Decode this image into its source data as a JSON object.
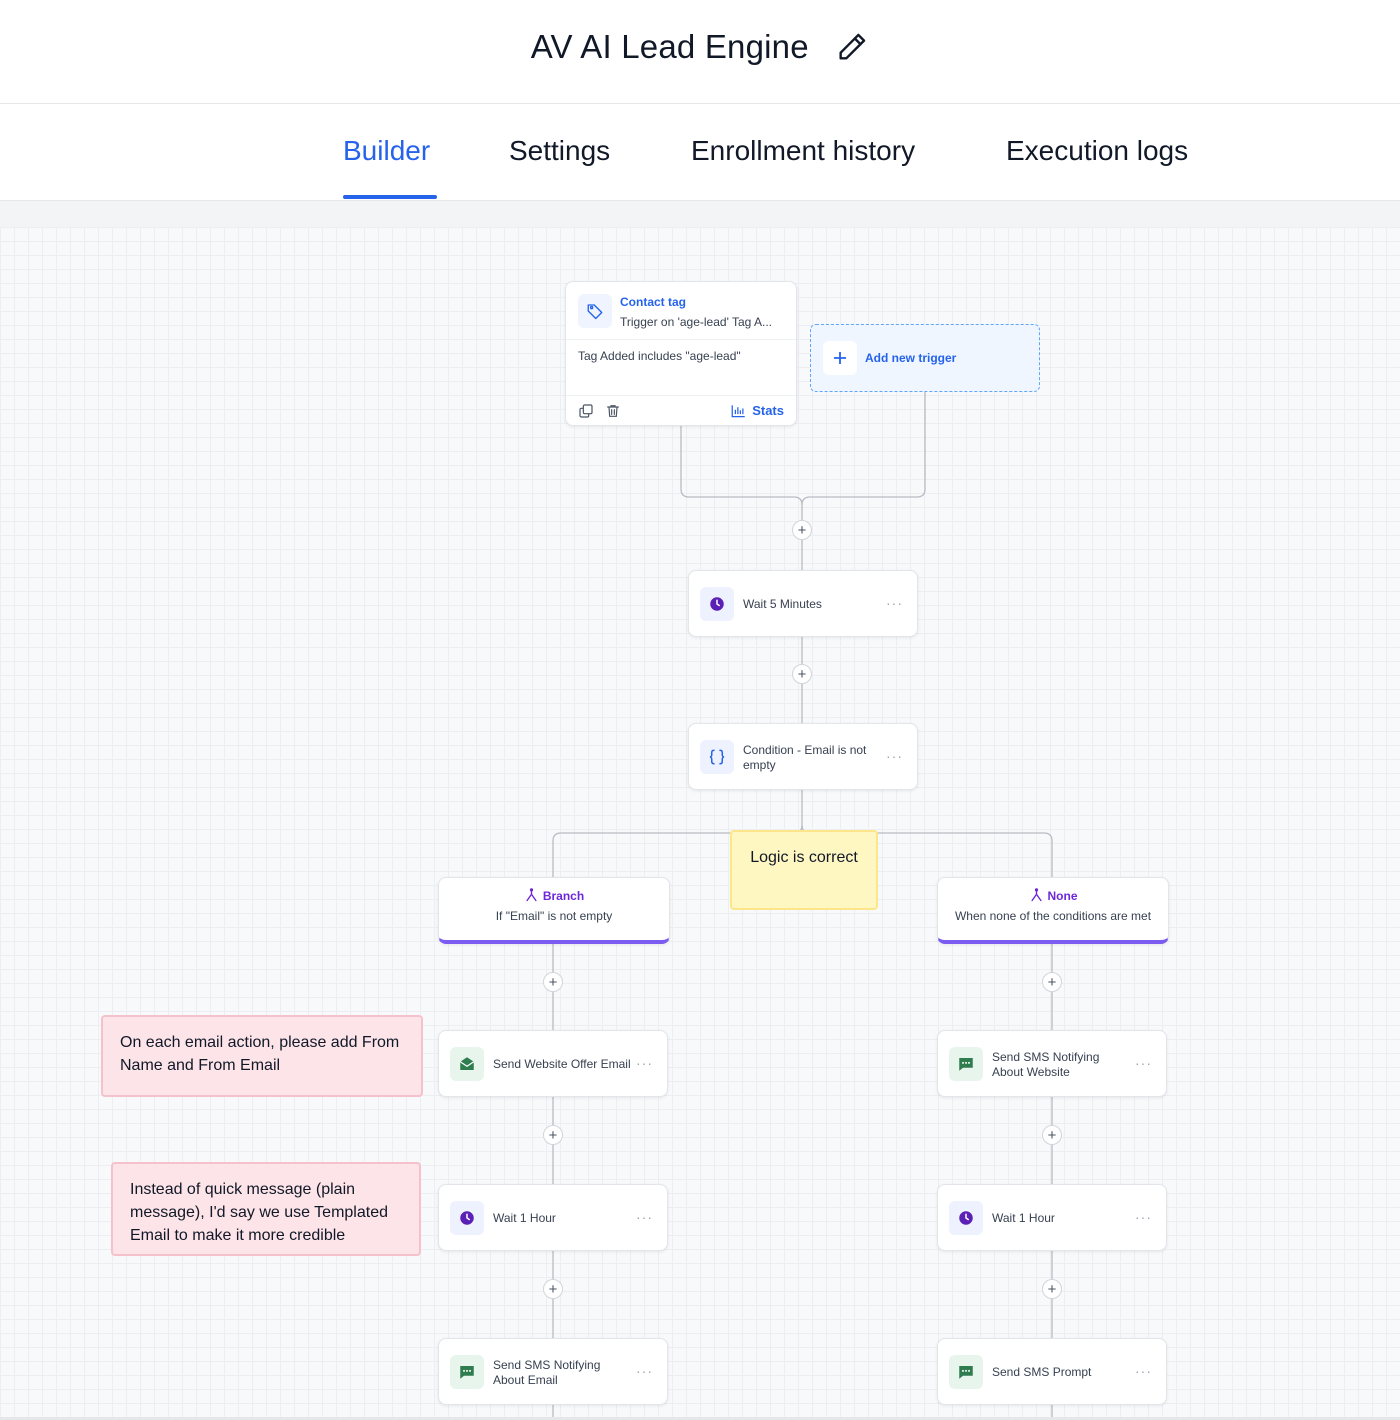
{
  "header": {
    "title": "AV AI Lead Engine",
    "edit_icon": "pencil-icon"
  },
  "tabs": [
    {
      "label": "Builder",
      "active": true
    },
    {
      "label": "Settings",
      "active": false
    },
    {
      "label": "Enrollment history",
      "active": false
    },
    {
      "label": "Execution logs",
      "active": false
    }
  ],
  "colors": {
    "accent": "#2563eb",
    "branch": "#7c5cf0",
    "wait_icon": "#5b21b6",
    "sms_icon": "#2f7d4f",
    "note_pink": "#fce4e8",
    "note_yellow": "#fff7c2"
  },
  "trigger": {
    "title": "Contact tag",
    "subtitle": "Trigger on 'age-lead' Tag A...",
    "filter": "Tag Added includes \"age-lead\"",
    "stats_label": "Stats"
  },
  "add_trigger": {
    "label": "Add new trigger"
  },
  "steps": {
    "wait_5": "Wait 5 Minutes",
    "condition": "Condition - Email is not empty"
  },
  "branches": {
    "left": {
      "name": "Branch",
      "desc": "If \"Email\" is not empty"
    },
    "right": {
      "name": "None",
      "desc": "When none of the conditions are met"
    }
  },
  "left_steps": [
    "Send Website Offer Email",
    "Wait 1 Hour",
    "Send SMS Notifying About Email"
  ],
  "right_steps": [
    "Send SMS Notifying About Website",
    "Wait 1 Hour",
    "Send SMS Prompt"
  ],
  "notes": {
    "logic": "Logic is correct",
    "from_fields": "On each email action, please add From Name and From Email",
    "templated": "Instead of quick message (plain message), I'd say we use Templated Email to make it more credible"
  },
  "plus_symbol": "+",
  "more_symbol": "···"
}
